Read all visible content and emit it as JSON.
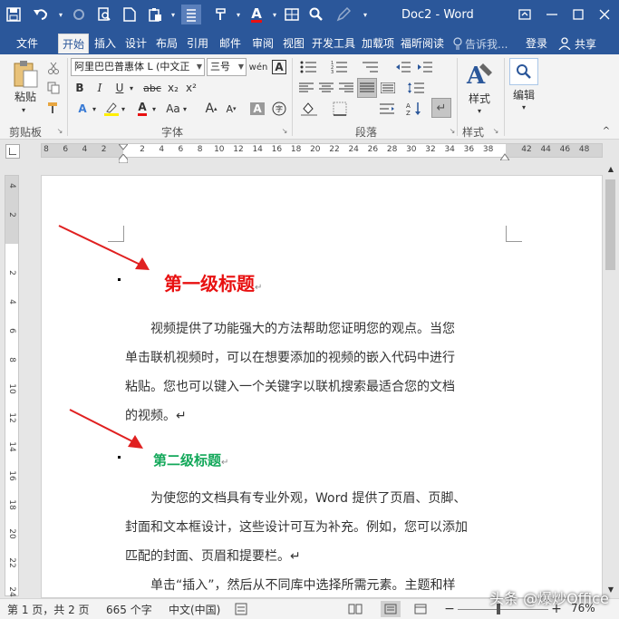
{
  "window": {
    "title": "Doc2 - Word",
    "quick_access": [
      "save-icon",
      "undo-icon",
      "redo-icon",
      "print-preview-icon",
      "new-document-icon",
      "paste-icon",
      "layout-icon",
      "format-painter-icon",
      "font-color-icon",
      "table-icon",
      "search-icon",
      "edit-icon"
    ]
  },
  "tabs": [
    {
      "label": "文件"
    },
    {
      "label": "开始"
    },
    {
      "label": "插入"
    },
    {
      "label": "设计"
    },
    {
      "label": "布局"
    },
    {
      "label": "引用"
    },
    {
      "label": "邮件"
    },
    {
      "label": "审阅"
    },
    {
      "label": "视图"
    },
    {
      "label": "开发工具"
    },
    {
      "label": "加载项"
    },
    {
      "label": "福昕阅读"
    }
  ],
  "tell_me": "告诉我...",
  "signin": "登录",
  "share": "共享",
  "ribbon": {
    "clipboard": {
      "paste": "粘贴",
      "label": "剪贴板"
    },
    "font": {
      "font_name": "阿里巴巴普惠体 L (中文正",
      "font_size": "三号",
      "label": "字体",
      "bold": "B",
      "italic": "I",
      "underline": "U",
      "strike": "abc",
      "subscript": "x₂",
      "superscript": "x²",
      "grow": "A",
      "shrink": "A",
      "aa": "Aa",
      "clear": "A"
    },
    "paragraph": {
      "label": "段落"
    },
    "styles": {
      "label": "样式",
      "button": "样式"
    },
    "editing": {
      "button": "编辑"
    }
  },
  "ruler": {
    "ticks": [
      "8",
      "6",
      "4",
      "2",
      "",
      "2",
      "4",
      "6",
      "8",
      "10",
      "12",
      "14",
      "16",
      "18",
      "20",
      "22",
      "24",
      "26",
      "28",
      "30",
      "32",
      "34",
      "36",
      "38",
      "",
      "42",
      "44",
      "46",
      "48"
    ]
  },
  "vruler": {
    "ticks": [
      "4",
      "2",
      "",
      "2",
      "4",
      "6",
      "8",
      "10",
      "12",
      "14",
      "16",
      "18",
      "20",
      "22",
      "24"
    ]
  },
  "document": {
    "heading1": "第一级标题",
    "heading2": "第二级标题",
    "para_mark": "↵",
    "para1": [
      "视频提供了功能强大的方法帮助您证明您的观点。当您",
      "单击联机视频时，可以在想要添加的视频的嵌入代码中进行",
      "粘贴。您也可以键入一个关键字以联机搜索最适合您的文档",
      "的视频。↵"
    ],
    "para2": [
      "为使您的文档具有专业外观，Word 提供了页眉、页脚、",
      "封面和文本框设计，这些设计可互为补充。例如，您可以添加",
      "匹配的封面、页眉和提要栏。↵"
    ],
    "para3": [
      "单击“插入”，然后从不同库中选择所需元素。主题和样"
    ]
  },
  "status": {
    "page": "第 1 页，共 2 页",
    "words": "665 个字",
    "language": "中文(中国)",
    "zoom": "76%"
  },
  "watermark": "头条 @爆炒Office",
  "colors": {
    "brand": "#2b579a",
    "heading1": "#e81010",
    "heading2": "#13a85a",
    "arrow": "#e02020"
  }
}
